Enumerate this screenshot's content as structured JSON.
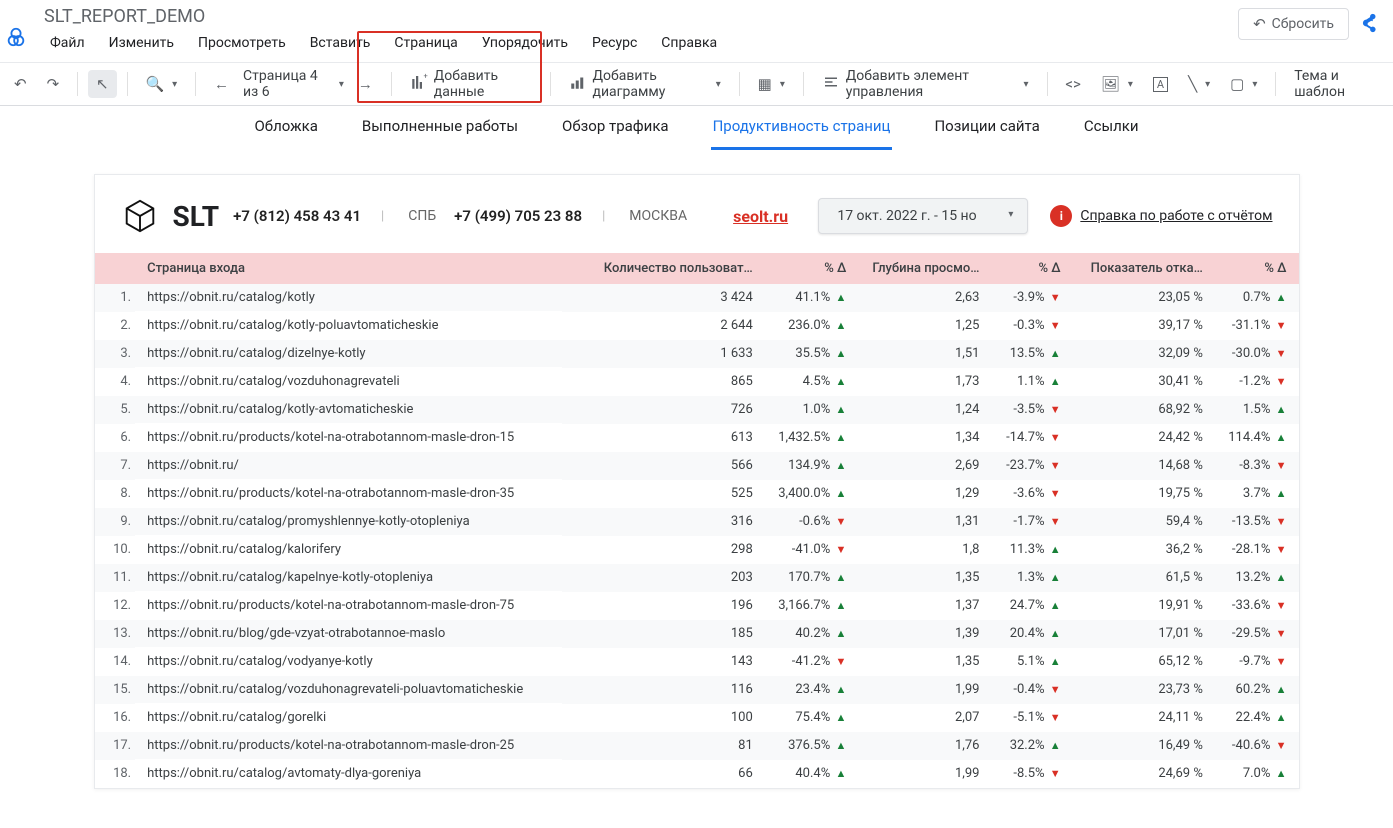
{
  "doc_title": "SLT_REPORT_DEMO",
  "menu": [
    "Файл",
    "Изменить",
    "Просмотреть",
    "Вставить",
    "Страница",
    "Упорядочить",
    "Ресурс",
    "Справка"
  ],
  "reset_label": "Сбросить",
  "toolbar": {
    "page_label": "Страница 4 из 6",
    "add_data": "Добавить данные",
    "add_chart": "Добавить диаграмму",
    "add_control": "Добавить элемент управления",
    "theme": "Тема и шаблон"
  },
  "tabs": {
    "items": [
      "Обложка",
      "Выполненные работы",
      "Обзор трафика",
      "Продуктивность страниц",
      "Позиции сайта",
      "Ссылки"
    ],
    "active": 3
  },
  "brand": {
    "name": "SLT",
    "phone1": "+7 (812) 458 43 41",
    "city1": "СПБ",
    "phone2": "+7 (499) 705 23 88",
    "city2": "МОСКВА",
    "site": "seolt.ru",
    "date_range": "17 окт. 2022 г. - 15 но",
    "help_link": "Справка по работе с отчётом"
  },
  "table": {
    "headers": [
      "",
      "Страница входа",
      "Количество пользоват…",
      "% Δ",
      "Глубина просмо…",
      "% Δ",
      "Показатель отка…",
      "% Δ"
    ],
    "rows": [
      {
        "n": "1.",
        "url": "https://obnit.ru/catalog/kotly",
        "users": "3 424",
        "ud": "41.1%",
        "ud_up": true,
        "depth": "2,63",
        "dd": "-3.9%",
        "dd_up": false,
        "bounce": "23,05 %",
        "bd": "0.7%",
        "bd_up": true
      },
      {
        "n": "2.",
        "url": "https://obnit.ru/catalog/kotly-poluavtomaticheskie",
        "users": "2 644",
        "ud": "236.0%",
        "ud_up": true,
        "depth": "1,25",
        "dd": "-0.3%",
        "dd_up": false,
        "bounce": "39,17 %",
        "bd": "-31.1%",
        "bd_up": false
      },
      {
        "n": "3.",
        "url": "https://obnit.ru/catalog/dizelnye-kotly",
        "users": "1 633",
        "ud": "35.5%",
        "ud_up": true,
        "depth": "1,51",
        "dd": "13.5%",
        "dd_up": true,
        "bounce": "32,09 %",
        "bd": "-30.0%",
        "bd_up": false
      },
      {
        "n": "4.",
        "url": "https://obnit.ru/catalog/vozduhonagrevateli",
        "users": "865",
        "ud": "4.5%",
        "ud_up": true,
        "depth": "1,73",
        "dd": "1.1%",
        "dd_up": true,
        "bounce": "30,41 %",
        "bd": "-1.2%",
        "bd_up": false
      },
      {
        "n": "5.",
        "url": "https://obnit.ru/catalog/kotly-avtomaticheskie",
        "users": "726",
        "ud": "1.0%",
        "ud_up": true,
        "depth": "1,24",
        "dd": "-3.5%",
        "dd_up": false,
        "bounce": "68,92 %",
        "bd": "1.5%",
        "bd_up": true
      },
      {
        "n": "6.",
        "url": "https://obnit.ru/products/kotel-na-otrabotannom-masle-dron-15",
        "users": "613",
        "ud": "1,432.5%",
        "ud_up": true,
        "depth": "1,34",
        "dd": "-14.7%",
        "dd_up": false,
        "bounce": "24,42 %",
        "bd": "114.4%",
        "bd_up": true
      },
      {
        "n": "7.",
        "url": "https://obnit.ru/",
        "users": "566",
        "ud": "134.9%",
        "ud_up": true,
        "depth": "2,69",
        "dd": "-23.7%",
        "dd_up": false,
        "bounce": "14,68 %",
        "bd": "-8.3%",
        "bd_up": false
      },
      {
        "n": "8.",
        "url": "https://obnit.ru/products/kotel-na-otrabotannom-masle-dron-35",
        "users": "525",
        "ud": "3,400.0%",
        "ud_up": true,
        "depth": "1,29",
        "dd": "-3.6%",
        "dd_up": false,
        "bounce": "19,75 %",
        "bd": "3.7%",
        "bd_up": true
      },
      {
        "n": "9.",
        "url": "https://obnit.ru/catalog/promyshlennye-kotly-otopleniya",
        "users": "316",
        "ud": "-0.6%",
        "ud_up": false,
        "depth": "1,31",
        "dd": "-1.7%",
        "dd_up": false,
        "bounce": "59,4 %",
        "bd": "-13.5%",
        "bd_up": false
      },
      {
        "n": "10.",
        "url": "https://obnit.ru/catalog/kalorifery",
        "users": "298",
        "ud": "-41.0%",
        "ud_up": false,
        "depth": "1,8",
        "dd": "11.3%",
        "dd_up": true,
        "bounce": "36,2 %",
        "bd": "-28.1%",
        "bd_up": false
      },
      {
        "n": "11.",
        "url": "https://obnit.ru/catalog/kapelnye-kotly-otopleniya",
        "users": "203",
        "ud": "170.7%",
        "ud_up": true,
        "depth": "1,35",
        "dd": "1.3%",
        "dd_up": true,
        "bounce": "61,5 %",
        "bd": "13.2%",
        "bd_up": true
      },
      {
        "n": "12.",
        "url": "https://obnit.ru/products/kotel-na-otrabotannom-masle-dron-75",
        "users": "196",
        "ud": "3,166.7%",
        "ud_up": true,
        "depth": "1,37",
        "dd": "24.7%",
        "dd_up": true,
        "bounce": "19,91 %",
        "bd": "-33.6%",
        "bd_up": false
      },
      {
        "n": "13.",
        "url": "https://obnit.ru/blog/gde-vzyat-otrabotannoe-maslo",
        "users": "185",
        "ud": "40.2%",
        "ud_up": true,
        "depth": "1,39",
        "dd": "20.4%",
        "dd_up": true,
        "bounce": "17,01 %",
        "bd": "-29.5%",
        "bd_up": false
      },
      {
        "n": "14.",
        "url": "https://obnit.ru/catalog/vodyanye-kotly",
        "users": "143",
        "ud": "-41.2%",
        "ud_up": false,
        "depth": "1,35",
        "dd": "5.1%",
        "dd_up": true,
        "bounce": "65,12 %",
        "bd": "-9.7%",
        "bd_up": false
      },
      {
        "n": "15.",
        "url": "https://obnit.ru/catalog/vozduhonagrevateli-poluavtomaticheskie",
        "users": "116",
        "ud": "23.4%",
        "ud_up": true,
        "depth": "1,99",
        "dd": "-0.4%",
        "dd_up": false,
        "bounce": "23,73 %",
        "bd": "60.2%",
        "bd_up": true
      },
      {
        "n": "16.",
        "url": "https://obnit.ru/catalog/gorelki",
        "users": "100",
        "ud": "75.4%",
        "ud_up": true,
        "depth": "2,07",
        "dd": "-5.1%",
        "dd_up": false,
        "bounce": "24,11 %",
        "bd": "22.4%",
        "bd_up": true
      },
      {
        "n": "17.",
        "url": "https://obnit.ru/products/kotel-na-otrabotannom-masle-dron-25",
        "users": "81",
        "ud": "376.5%",
        "ud_up": true,
        "depth": "1,76",
        "dd": "32.2%",
        "dd_up": true,
        "bounce": "16,49 %",
        "bd": "-40.6%",
        "bd_up": false
      },
      {
        "n": "18.",
        "url": "https://obnit.ru/catalog/avtomaty-dlya-goreniya",
        "users": "66",
        "ud": "40.4%",
        "ud_up": true,
        "depth": "1,99",
        "dd": "-8.5%",
        "dd_up": false,
        "bounce": "24,69 %",
        "bd": "7.0%",
        "bd_up": true
      }
    ]
  }
}
